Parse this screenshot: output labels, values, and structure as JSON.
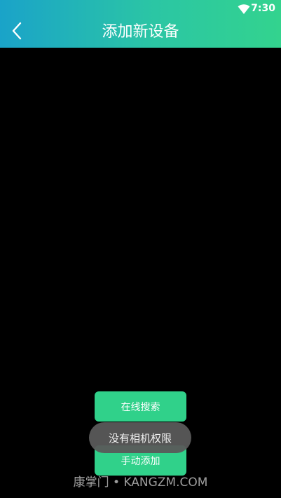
{
  "status_bar": {
    "time": "7:30",
    "wifi_icon": "wifi-icon"
  },
  "header": {
    "title": "添加新设备",
    "back_icon": "chevron-left-icon",
    "gradient_start": "#1aa3c9",
    "gradient_end": "#33d38e"
  },
  "actions": {
    "online_search_label": "在线搜索",
    "manual_add_label": "手动添加",
    "button_color": "#30d18a"
  },
  "toast": {
    "message": "没有相机权限"
  },
  "watermark": {
    "text": "康掌门 • KANGZM.COM"
  }
}
